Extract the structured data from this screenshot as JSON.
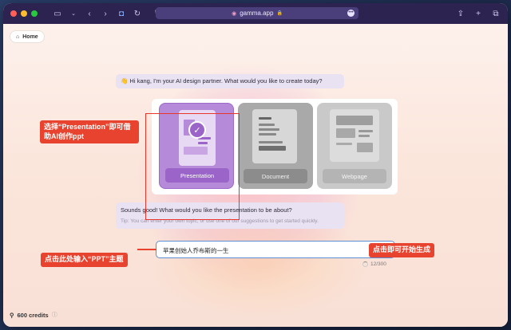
{
  "browser": {
    "url": "gamma.app",
    "toolbar_icons": [
      "sidebar-icon",
      "chevron-down-icon",
      "back-icon",
      "forward-icon",
      "bookmark-icon",
      "refresh-icon",
      "shield-icon",
      "share-icon",
      "plus-icon",
      "tabs-icon"
    ]
  },
  "nav": {
    "home_label": "Home"
  },
  "chat": {
    "greeting": "👋 Hi kang, I'm your AI design partner. What would you like to create today?",
    "reply": "Sounds good! What would you like the presentation to be about?",
    "tip": "Tip: You can enter your own topic, or use one of our suggestions to get started quickly."
  },
  "options": {
    "presentation": "Presentation",
    "document": "Document",
    "webpage": "Webpage",
    "selected": "Presentation"
  },
  "input": {
    "value": "苹果创始人乔布斯的一生",
    "counter": "12/300"
  },
  "footer": {
    "credits": "600 credits"
  },
  "annotations": {
    "select_hint": "选择“Presentation”即可借助AI创作ppt",
    "input_hint": "点击此处输入“PPT”主题",
    "send_hint": "点击即可开始生成"
  },
  "colors": {
    "accent": "#9b64c8",
    "annotation": "#e8432e",
    "toolbar": "#2c2350"
  }
}
